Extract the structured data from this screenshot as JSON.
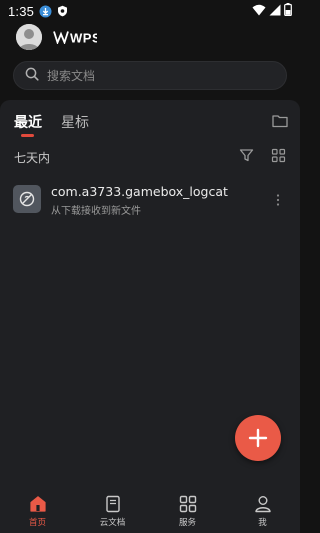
{
  "status_bar": {
    "time": "1:35",
    "battery_level": 0.4,
    "icons": [
      "download-badge-icon",
      "shield-icon",
      "wifi-icon",
      "cellular-signal-icon",
      "battery-icon"
    ]
  },
  "header": {
    "app_logo_text": "WPS",
    "avatar_icon": "user-avatar-icon"
  },
  "search": {
    "placeholder": "搜索文档",
    "icon": "search-icon"
  },
  "tabs": [
    {
      "label": "最近",
      "selected": true
    },
    {
      "label": "星标",
      "selected": false
    }
  ],
  "section": {
    "label": "七天内"
  },
  "files": [
    {
      "name": "com.a3733.gamebox_logcat",
      "subtitle": "从下载接收到新文件",
      "icon": "unknown-file-icon"
    }
  ],
  "bottom_nav": [
    {
      "label": "首页",
      "icon": "home-icon",
      "active": true
    },
    {
      "label": "云文档",
      "icon": "cloud-document-icon",
      "active": false
    },
    {
      "label": "服务",
      "icon": "apps-grid-icon",
      "active": false
    },
    {
      "label": "我",
      "icon": "person-icon",
      "active": false
    }
  ],
  "colors": {
    "accent": "#ea5a47",
    "background": "#131313",
    "panel": "#1f2023"
  }
}
